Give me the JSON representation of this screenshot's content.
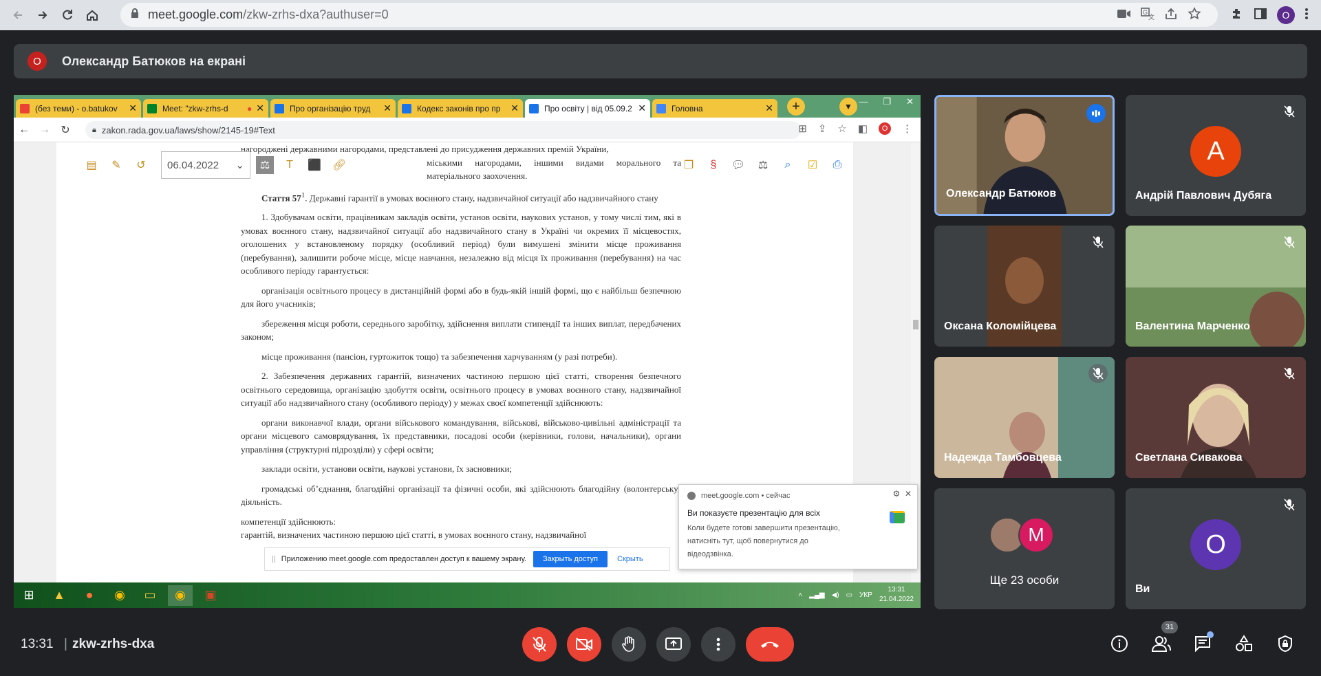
{
  "browser": {
    "url_host": "meet.google.com",
    "url_path": "/zkw-zrhs-dxa?authuser=0",
    "profile_letter": "O"
  },
  "presenter": {
    "avatar_letter": "О",
    "text": "Олександр Батюков на екрані"
  },
  "shared": {
    "tabs": [
      {
        "label": "(без теми) - o.batukov",
        "icon_color": "#ea4335"
      },
      {
        "label": "Meet: \"zkw-zrhs-d",
        "icon_color": "#00832d"
      },
      {
        "label": "Про організацію труд",
        "icon_color": "#1a73e8"
      },
      {
        "label": "Кодекс законів про пр",
        "icon_color": "#1a73e8"
      },
      {
        "label": "Про освіту | від 05.09.2",
        "icon_color": "#1a73e8"
      },
      {
        "label": "Головна",
        "icon_color": "#4285f4"
      }
    ],
    "url": "zakon.rada.gov.ua/laws/show/2145-19#Text",
    "profile_letter": "O",
    "date_value": "06.04.2022",
    "doc_top": "нагороджені державними нагородами, представлені до присудження державних премій України,",
    "doc_top2": "міськими нагородами, іншими видами морального та матеріального заохочення.",
    "art_title": "Стаття 57",
    "art_sup": "1",
    "art_text": ". Державні гарантії в умовах воєнного стану, надзвичайної ситуації або надзвичайного стану",
    "paras": [
      "1. Здобувачам освіти, працівникам закладів освіти, установ освіти, наукових установ, у тому числі тим, які в умовах воєнного стану, надзвичайної ситуації або надзвичайного стану в Україні чи окремих її місцевостях, оголошених у встановленому порядку (особливий період) були вимушені змінити місце проживання (перебування), залишити робоче місце, місце навчання, незалежно від місця їх проживання (перебування) на час особливого періоду гарантується:",
      "організація освітнього процесу в дистанційній формі або в будь-якій іншій формі, що є найбільш безпечною для його учасників;",
      "збереження місця роботи, середнього заробітку, здійснення виплати стипендії та інших виплат, передбачених законом;",
      "місце проживання (пансіон, гуртожиток тощо) та забезпечення харчуванням (у разі потреби).",
      "2. Забезпечення державних гарантій, визначених частиною першою цієї статті, створення безпечного освітнього середовища, організацію здобуття освіти, освітнього процесу в умовах воєнного стану, надзвичайної ситуації або надзвичайного стану (особливого періоду) у межах своєї компетенції здійснюють:",
      "органи виконавчої влади, органи військового командування, військові, військово-цивільні адміністрації та органи місцевого самоврядування, їх представники, посадові особи (керівники, голови, начальники), органи управління (структурні підрозділи) у сфері освіти;",
      "заклади освіти, установи освіти, наукові установи, їх засновники;",
      "громадські об’єднання, благодійні організації та фізичні особи, які здійснюють благодійну (волонтерську) діяльність."
    ],
    "doc_bottom1": "компетенції здійснюють:",
    "doc_bottom2": "гарантій, визначених частиною першою цієї статті, в умовах воєнного стану, надзвичайної",
    "share_bar": {
      "text": "Приложению meet.google.com предоставлен доступ к вашему экрану.",
      "stop": "Закрыть доступ",
      "hide": "Скрыть"
    },
    "notification": {
      "source": "meet.google.com",
      "when": "• сейчас",
      "title": "Ви показуєте презентацію для всіх",
      "message": "Коли будете готові завершити презентацію, натисніть тут, щоб повернутися до відеодзвінка."
    },
    "taskbar": {
      "lang": "УКР",
      "time": "13:31",
      "date": "21.04.2022"
    }
  },
  "participants": [
    {
      "name": "Олександр Батюков",
      "type": "video",
      "speaking": true
    },
    {
      "name": "Андрій Павлович Дубяга",
      "type": "avatar",
      "letter": "А",
      "color": "#e8430a"
    },
    {
      "name": "Оксана Коломійцева",
      "type": "video"
    },
    {
      "name": "Валентина Марченко",
      "type": "video"
    },
    {
      "name": "Надежда Тамбовцева",
      "type": "video"
    },
    {
      "name": "Светлана Сивакова",
      "type": "video"
    }
  ],
  "more": {
    "label": "Ще 23 особи",
    "letter": "M"
  },
  "self": {
    "name": "Ви",
    "letter": "O",
    "color": "#5e35b1"
  },
  "bottom": {
    "time": "13:31",
    "sep": "|",
    "code": "zkw-zrhs-dxa",
    "people_count": "31"
  }
}
